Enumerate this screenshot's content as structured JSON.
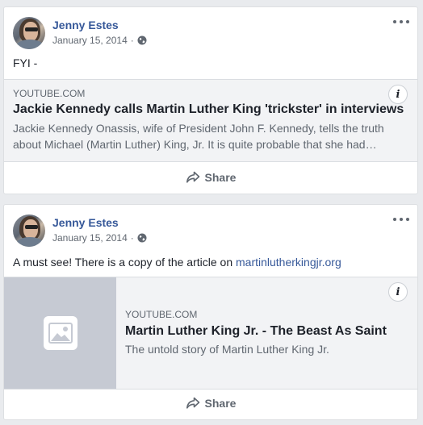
{
  "colors": {
    "background": "#e9ebee",
    "card": "#ffffff",
    "author_link": "#365899",
    "secondary_text": "#606770",
    "link_card_bg": "#f2f3f5",
    "thumbnail_bg": "#c6cad3"
  },
  "posts": [
    {
      "author": "Jenny Estes",
      "date": "January 15, 2014",
      "privacy_icon": "globe-icon",
      "menu_icon": "more-options-icon",
      "text": "FYI -",
      "link": {
        "domain": "YOUTUBE.COM",
        "title": "Jackie Kennedy calls Martin Luther King 'trickster' in interviews",
        "description": "Jackie Kennedy Onassis, wife of President John F. Kennedy, tells the truth about Michael (Martin Luther) King, Jr. It is quite probable that she had…",
        "info_label": "i"
      },
      "share_label": "Share"
    },
    {
      "author": "Jenny Estes",
      "date": "January 15, 2014",
      "privacy_icon": "globe-icon",
      "menu_icon": "more-options-icon",
      "text_prefix": "A must see! There is a copy of the article on ",
      "text_link": "martinlutherkingjr.org",
      "link": {
        "domain": "YOUTUBE.COM",
        "title": "Martin Luther King Jr. - The Beast As Saint",
        "description": "The untold story of Martin Luther King Jr.",
        "info_label": "i",
        "thumbnail_icon": "image-placeholder-icon"
      },
      "share_label": "Share"
    }
  ]
}
